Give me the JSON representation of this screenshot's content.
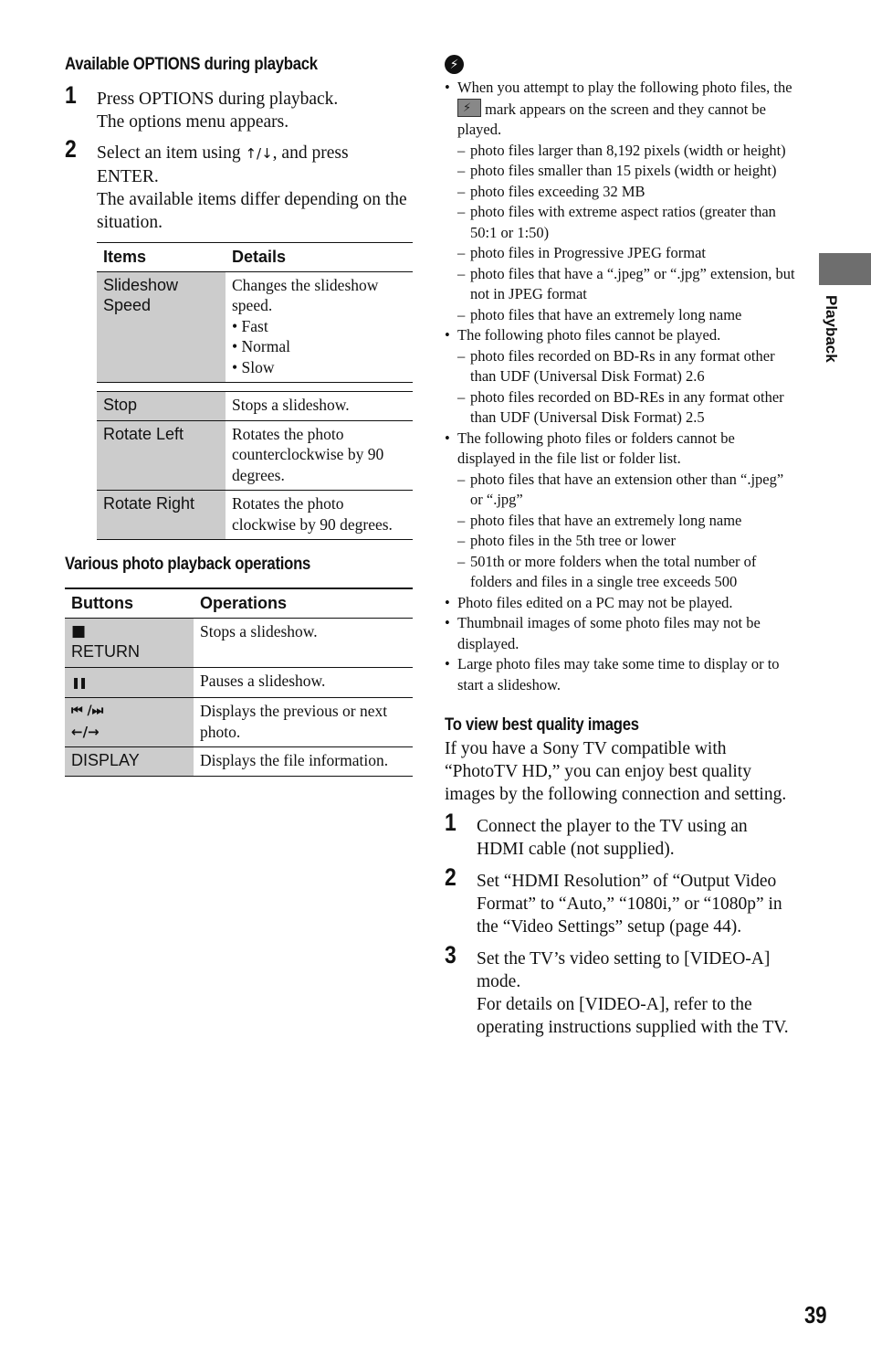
{
  "left": {
    "options_heading": "Available OPTIONS during playback",
    "steps": [
      {
        "num": "1",
        "lines": [
          "Press OPTIONS during playback.",
          "The options menu appears."
        ]
      },
      {
        "num": "2",
        "line1_pre": "Select an item using ",
        "line1_arrows": "↑/↓",
        "line1_post": ", and press ENTER.",
        "line2": "The available items differ depending on the situation."
      }
    ],
    "options_table": {
      "headers": [
        "Items",
        "Details"
      ],
      "rows": [
        {
          "item": "Slideshow Speed",
          "detail": "Changes the slideshow speed.",
          "bullets": [
            "Fast",
            "Normal",
            "Slow"
          ]
        },
        {
          "item": "Stop",
          "detail": "Stops a slideshow."
        },
        {
          "item": "Rotate Left",
          "detail": "Rotates the photo counterclockwise by 90 degrees."
        },
        {
          "item": "Rotate Right",
          "detail": "Rotates the photo clockwise by 90 degrees."
        }
      ]
    },
    "ops_heading": "Various photo playback operations",
    "ops_table": {
      "headers": [
        "Buttons",
        "Operations"
      ],
      "rows": [
        {
          "button_icon": "■",
          "button": "RETURN",
          "op": "Stops a slideshow."
        },
        {
          "button_icon": "❚❚",
          "button": "",
          "op": "Pauses a slideshow."
        },
        {
          "button_icon": "⏮ /⏭",
          "button_icon2": "←/→",
          "button": "",
          "op": "Displays the previous or next photo."
        },
        {
          "button": "DISPLAY",
          "op": "Displays the file information."
        }
      ]
    }
  },
  "right": {
    "note_icon": "note-lightning-icon",
    "notes": [
      {
        "pre": "When you attempt to play the following photo files, the ",
        "post": " mark appears on the screen and they cannot be played.",
        "subs": [
          "photo files larger than 8,192 pixels (width or height)",
          "photo files smaller than 15 pixels (width or height)",
          "photo files exceeding 32 MB",
          "photo files with extreme aspect ratios (greater than 50:1 or 1:50)",
          "photo files in Progressive JPEG format",
          "photo files that have a “.jpeg” or “.jpg” extension, but not in JPEG format",
          "photo files that have an extremely long name"
        ]
      },
      {
        "text": "The following photo files cannot be played.",
        "subs": [
          "photo files recorded on BD-Rs in any format other than UDF (Universal Disk Format) 2.6",
          "photo files recorded on BD-REs in any format other than UDF (Universal Disk Format) 2.5"
        ]
      },
      {
        "text": "The following photo files or folders cannot be displayed in the file list or folder list.",
        "subs": [
          "photo files that have an extension other than “.jpeg” or “.jpg”",
          "photo files that have an extremely long name",
          "photo files in the 5th tree or lower",
          "501th or more folders when the total number of folders and files in a single tree exceeds 500"
        ]
      },
      {
        "text": "Photo files edited on a PC may not be played."
      },
      {
        "text": "Thumbnail images of some photo files may not be displayed."
      },
      {
        "text": "Large photo files may take some time to display or to start a slideshow."
      }
    ],
    "quality_heading": "To view best quality images",
    "quality_intro": "If you have a Sony TV compatible with “PhotoTV HD,” you can enjoy best quality images by the following connection and setting.",
    "quality_steps": [
      {
        "num": "1",
        "text": "Connect the player to the TV using an HDMI cable (not supplied)."
      },
      {
        "num": "2",
        "text": "Set “HDMI Resolution” of “Output Video Format” to “Auto,” “1080i,” or “1080p” in the “Video Settings” setup (page 44)."
      },
      {
        "num": "3",
        "text": "Set the TV’s video setting to [VIDEO-A] mode.",
        "text2": "For details on [VIDEO-A], refer to the operating instructions supplied with the TV."
      }
    ]
  },
  "side_tab_label": "Playback",
  "page_number": "39"
}
